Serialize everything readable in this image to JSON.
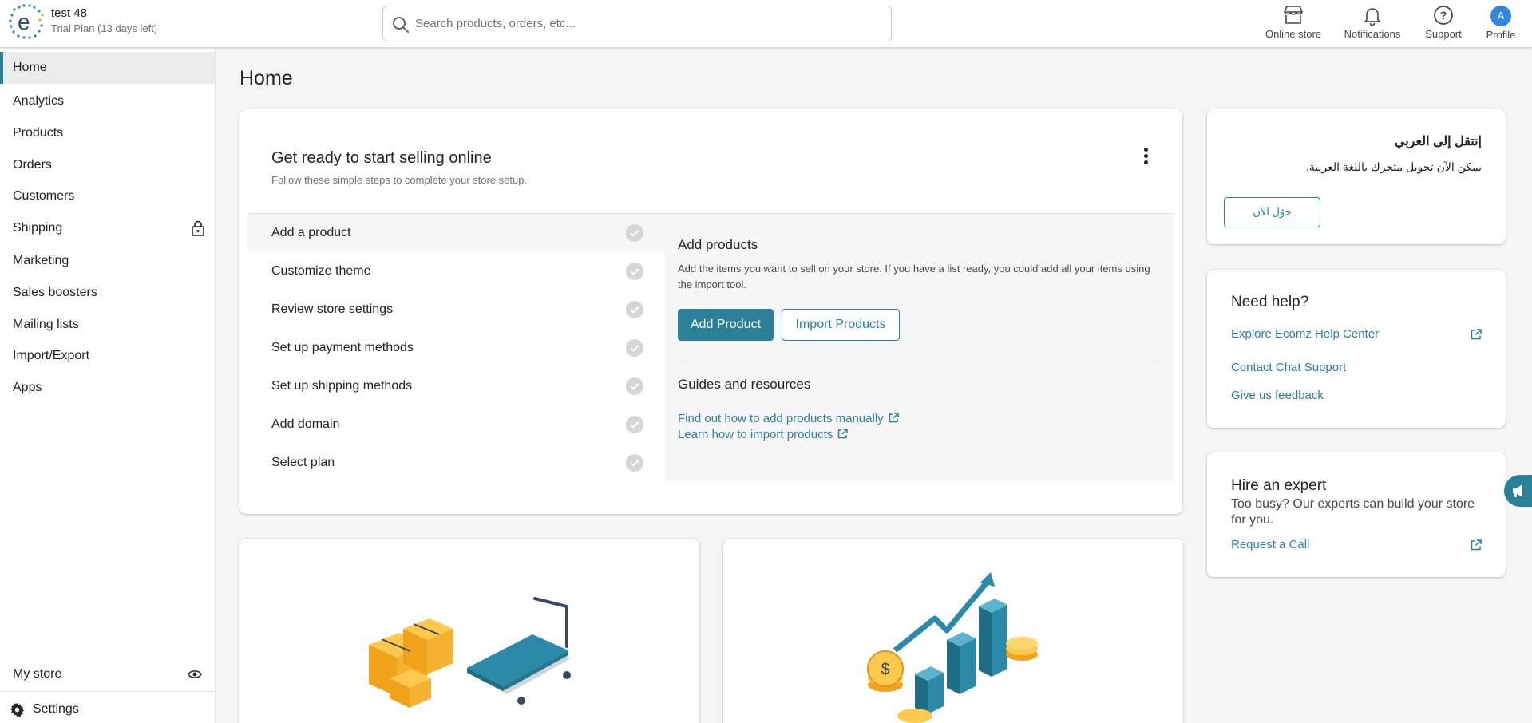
{
  "header": {
    "store_name": "test 48",
    "plan_text": "Trial Plan (13 days left)",
    "search_placeholder": "Search products, orders, etc...",
    "online_store_label": "Online store",
    "notifications_label": "Notifications",
    "support_label": "Support",
    "profile_label": "Profile",
    "avatar_initial": "A"
  },
  "sidebar": {
    "items": [
      {
        "label": "Home",
        "active": true
      },
      {
        "label": "Analytics"
      },
      {
        "label": "Products"
      },
      {
        "label": "Orders"
      },
      {
        "label": "Customers"
      },
      {
        "label": "Shipping",
        "icon": "lock-icon"
      },
      {
        "label": "Marketing"
      },
      {
        "label": "Sales boosters"
      },
      {
        "label": "Mailing lists"
      },
      {
        "label": "Import/Export"
      },
      {
        "label": "Apps"
      }
    ],
    "my_store_label": "My store",
    "settings_label": "Settings"
  },
  "main": {
    "page_title": "Home",
    "setup": {
      "title": "Get ready to start selling online",
      "subtitle": "Follow these simple steps to complete your store setup.",
      "steps": [
        "Add a product",
        "Customize theme",
        "Review store settings",
        "Set up payment methods",
        "Set up shipping methods",
        "Add domain",
        "Select plan"
      ],
      "detail_title": "Add products",
      "detail_text": "Add the items you want to sell on your store. If you have a list ready, you could add all your items using the import tool.",
      "add_product_label": "Add Product",
      "import_products_label": "Import Products",
      "guides_title": "Guides and resources",
      "guide_link_1": "Find out how to add products manually",
      "guide_link_2": "Learn how to import products"
    },
    "arabic_card": {
      "title": "إنتقل إلى العربي",
      "text": "يمكن الآن تحويل متجرك باللغة العربية.",
      "button": "حوّل الآن"
    },
    "help_card": {
      "title": "Need help?",
      "link_1": "Explore Ecomz Help Center",
      "link_2": "Contact Chat Support",
      "link_3": "Give us feedback"
    },
    "expert_card": {
      "title": "Hire an expert",
      "text": "Too busy? Our experts can build your store for you.",
      "link": "Request a Call"
    }
  },
  "colors": {
    "accent": "#2a7f99",
    "avatar": "#2f87e0",
    "illustration_orange": "#f5a623",
    "illustration_teal": "#2a8aa8"
  }
}
